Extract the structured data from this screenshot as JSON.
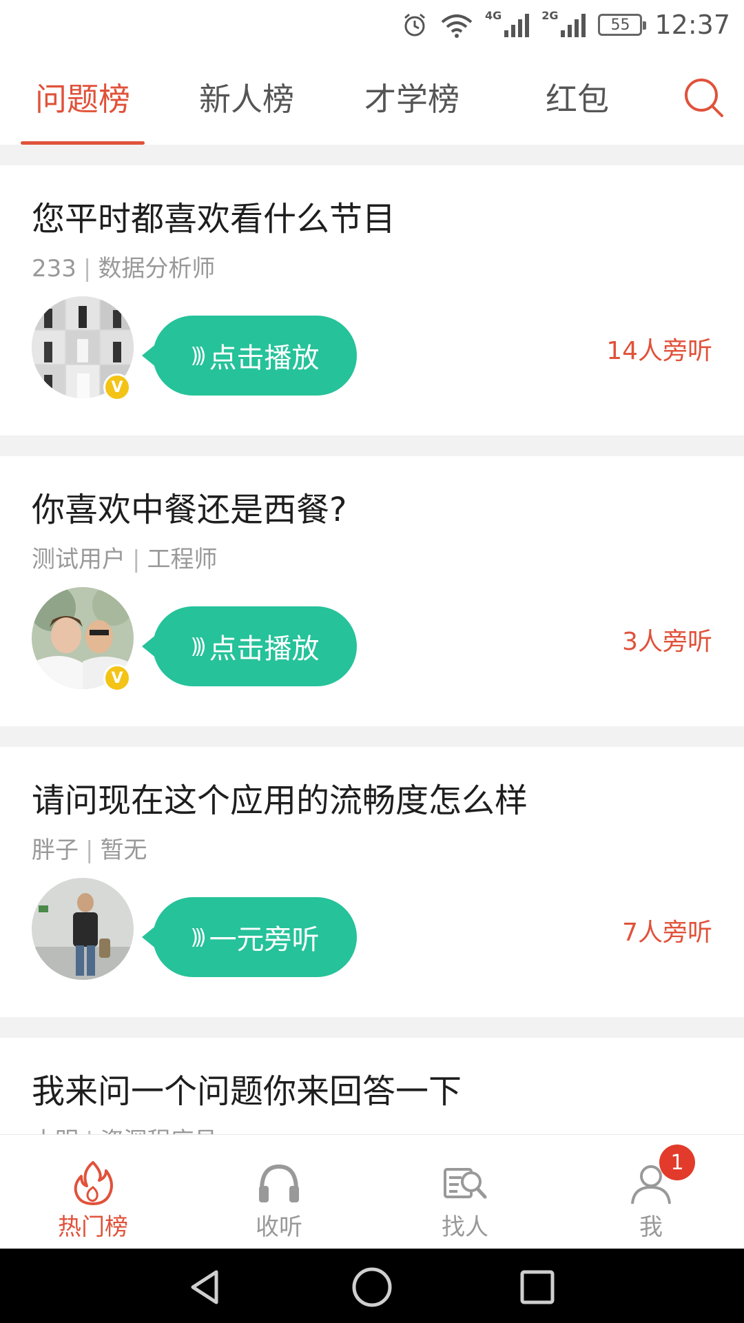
{
  "status_bar": {
    "network_1": "4G",
    "network_2": "2G",
    "battery": "55",
    "time": "12:37"
  },
  "top_tabs": {
    "items": [
      {
        "label": "问题榜",
        "active": true
      },
      {
        "label": "新人榜",
        "active": false
      },
      {
        "label": "才学榜",
        "active": false
      },
      {
        "label": "红包",
        "active": false
      }
    ],
    "search_icon": "search-icon",
    "accent_color": "#e0523a"
  },
  "feed": {
    "cards": [
      {
        "title": "您平时都喜欢看什么节目",
        "author": "233",
        "role": "数据分析师",
        "button": "点击播放",
        "listeners": "14人旁听",
        "verified": true
      },
      {
        "title": "你喜欢中餐还是西餐?",
        "author": "测试用户",
        "role": "工程师",
        "button": "点击播放",
        "listeners": "3人旁听",
        "verified": true
      },
      {
        "title": "请问现在这个应用的流畅度怎么样",
        "author": "胖子",
        "role": "暂无",
        "button": "一元旁听",
        "listeners": "7人旁听",
        "verified": false
      },
      {
        "title": "我来问一个问题你来回答一下",
        "author": "小明",
        "role": "资深程序员",
        "button": "",
        "listeners": "",
        "verified": false
      }
    ],
    "button_color": "#26c29a",
    "separator": "|"
  },
  "bottom_nav": {
    "items": [
      {
        "label": "热门榜",
        "icon": "flame-icon",
        "active": true
      },
      {
        "label": "收听",
        "icon": "headphones-icon",
        "active": false
      },
      {
        "label": "找人",
        "icon": "find-people-icon",
        "active": false
      },
      {
        "label": "我",
        "icon": "user-icon",
        "active": false,
        "badge": "1"
      }
    ]
  }
}
